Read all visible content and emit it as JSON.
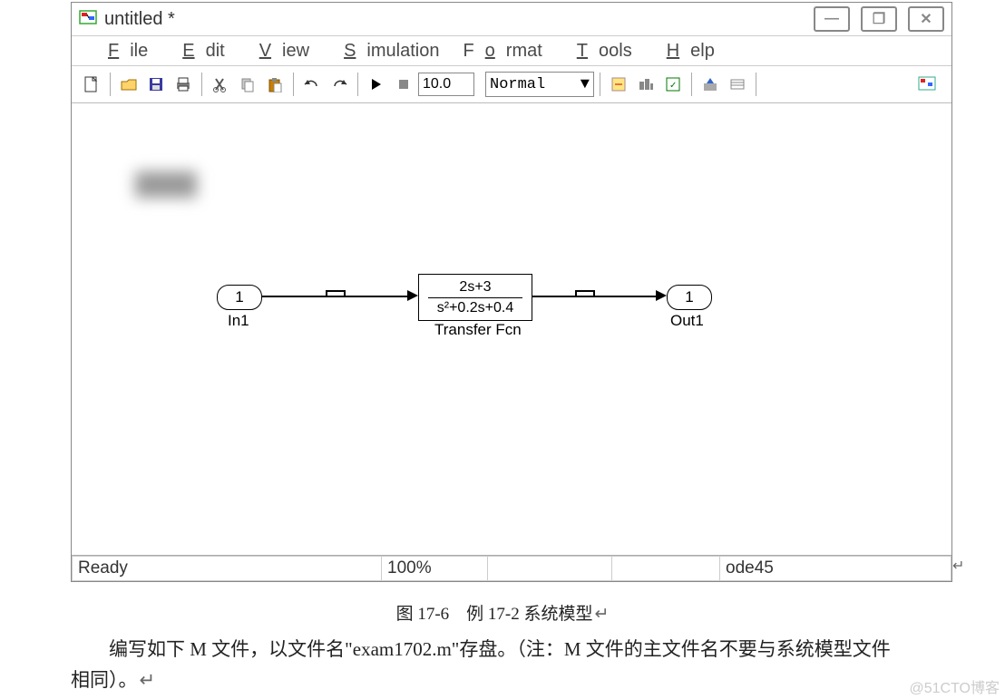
{
  "window": {
    "title": "untitled *"
  },
  "menu": {
    "file": "File",
    "edit": "Edit",
    "view": "View",
    "simulation": "Simulation",
    "format": "Format",
    "tools": "Tools",
    "help": "Help"
  },
  "toolbar": {
    "sim_time": "10.0",
    "mode_selected": "Normal"
  },
  "model": {
    "in_port": {
      "number": "1",
      "label": "In1"
    },
    "out_port": {
      "number": "1",
      "label": "Out1"
    },
    "tfcn": {
      "numerator": "2s+3",
      "denominator": "s²+0.2s+0.4",
      "label": "Transfer Fcn"
    }
  },
  "status": {
    "ready": "Ready",
    "zoom": "100%",
    "solver": "ode45"
  },
  "caption": "图 17-6　例 17-2 系统模型",
  "body_line1": "编写如下 M 文件，以文件名\"exam1702.m\"存盘。（注：M 文件的主文件名不要与系统模型文件",
  "body_line2": "相同）。",
  "watermark": "@51CTO博客"
}
